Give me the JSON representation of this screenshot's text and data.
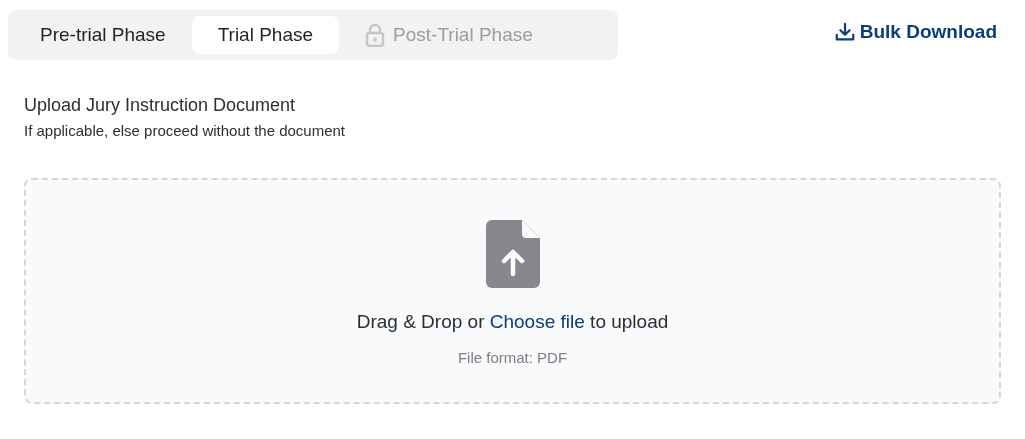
{
  "tabs": [
    {
      "label": "Pre-trial Phase",
      "selected": false,
      "locked": false
    },
    {
      "label": "Trial Phase",
      "selected": true,
      "locked": false
    },
    {
      "label": "Post-Trial Phase",
      "selected": false,
      "locked": true
    }
  ],
  "bulk_download": {
    "label": "Bulk Download"
  },
  "upload": {
    "title": "Upload Jury Instruction Document",
    "subtitle": "If applicable, else proceed without the document",
    "dropzone": {
      "prompt_before": "Drag & Drop or",
      "link": "Choose file",
      "prompt_after": "to upload",
      "format_note": "File format: PDF"
    }
  }
}
